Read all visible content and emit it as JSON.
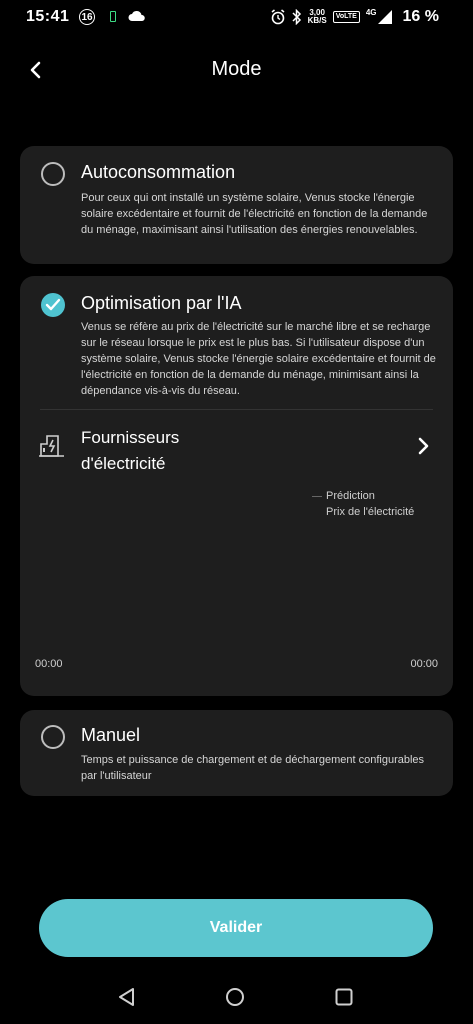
{
  "status_bar": {
    "time": "15:41",
    "notif_badge": "16",
    "speed_top": "3,00",
    "speed_bottom": "KB/S",
    "volte": "VoLTE",
    "network": "4G",
    "battery": "16 %"
  },
  "header": {
    "title": "Mode"
  },
  "options": [
    {
      "title": "Autoconsommation",
      "description": "Pour ceux qui ont installé un système solaire, Venus stocke l'énergie solaire excédentaire et fournit de l'électricité en fonction de la demande du ménage, maximisant ainsi l'utilisation des énergies renouvelables.",
      "selected": false
    },
    {
      "title": "Optimisation par l'IA",
      "description": "Venus se réfère au prix de l'électricité sur le marché libre et se recharge sur le réseau lorsque le prix est le plus bas. Si l'utilisateur dispose d'un système solaire, Venus stocke l'énergie solaire excédentaire et fournit de l'électricité en fonction de la demande du ménage, minimisant ainsi la dépendance vis-à-vis du réseau.",
      "selected": true
    },
    {
      "title": "Manuel",
      "description": "Temps et puissance de chargement et de déchargement configurables par l'utilisateur",
      "selected": false
    }
  ],
  "provider": {
    "label_line1": "Fournisseurs",
    "label_line2": "d'électricité"
  },
  "chart": {
    "legend": [
      "Prédiction",
      "Prix de l'électricité"
    ],
    "x_start": "00:00",
    "x_end": "00:00"
  },
  "validate_label": "Valider",
  "colors": {
    "accent": "#5cc6cf",
    "card_bg": "#1e1e1e",
    "background": "#000000"
  }
}
